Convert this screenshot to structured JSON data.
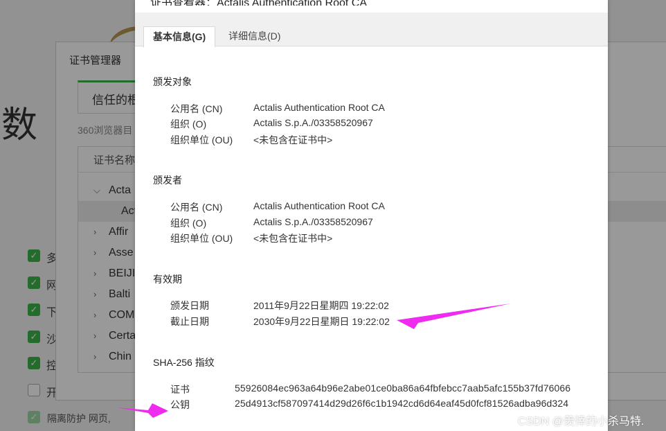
{
  "background": {
    "big_char": "数",
    "checkbox_labels": [
      "多",
      "网",
      "下",
      "沙",
      "控",
      "开"
    ],
    "footer_check_label": "隔离防护  网页,"
  },
  "manager": {
    "title": "证书管理器",
    "tab_label": "信任的根",
    "description": "360浏览器目",
    "column_header": "证书名称",
    "tree": [
      {
        "chev": "⌵",
        "label": "Acta"
      },
      {
        "chev": "",
        "label": "Act"
      },
      {
        "chev": "›",
        "label": "Affir"
      },
      {
        "chev": "›",
        "label": "Asse"
      },
      {
        "chev": "›",
        "label": "BEIJI"
      },
      {
        "chev": "›",
        "label": "Balti"
      },
      {
        "chev": "›",
        "label": "COM"
      },
      {
        "chev": "›",
        "label": "Certa"
      },
      {
        "chev": "›",
        "label": "Chin"
      }
    ]
  },
  "dialog": {
    "clipped_title": "证书查看器：Actalis Authentication Root CA",
    "tabs": {
      "basic": "基本信息(G)",
      "details": "详细信息(D)"
    },
    "issued_to": {
      "heading": "颁发对象",
      "cn_label": "公用名 (CN)",
      "cn": "Actalis Authentication Root CA",
      "o_label": "组织 (O)",
      "o": "Actalis S.p.A./03358520967",
      "ou_label": "组织单位 (OU)",
      "ou": "<未包含在证书中>"
    },
    "issued_by": {
      "heading": "颁发者",
      "cn_label": "公用名 (CN)",
      "cn": "Actalis Authentication Root CA",
      "o_label": "组织 (O)",
      "o": "Actalis S.p.A./03358520967",
      "ou_label": "组织单位 (OU)",
      "ou": "<未包含在证书中>"
    },
    "validity": {
      "heading": "有效期",
      "issued_label": "颁发日期",
      "issued": "2011年9月22日星期四 19:22:02",
      "expires_label": "截止日期",
      "expires": "2030年9月22日星期日 19:22:02"
    },
    "fingerprints": {
      "heading": "SHA-256 指纹",
      "cert_label": "证书",
      "cert": "55926084ec963a64b96e2abe01ce0ba86a64fbfebcc7aab5afc155b37fd76066",
      "key_label": "公钥",
      "key": "25d4913cf587097414d29d26f6c1b1942cd6d64eaf45d0fcf81526adba96d324"
    }
  },
  "watermark": "CSDN @羡悻的小杀马特.",
  "colors": {
    "arrow": "#ee2bee",
    "accent_green": "#3bb54a"
  }
}
